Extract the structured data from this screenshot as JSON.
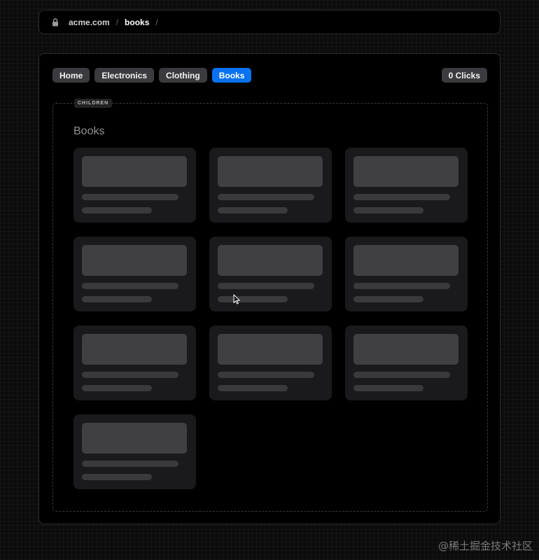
{
  "address_bar": {
    "domain": "acme.com",
    "separator": "/",
    "current": "books",
    "trailing_separator": "/"
  },
  "nav": {
    "tabs": [
      {
        "label": "Home",
        "active": false
      },
      {
        "label": "Electronics",
        "active": false
      },
      {
        "label": "Clothing",
        "active": false
      },
      {
        "label": "Books",
        "active": true
      }
    ],
    "clicks_label": "0 Clicks"
  },
  "children": {
    "label": "CHILDREN",
    "title": "Books",
    "card_count": 10
  },
  "colors": {
    "accent": "#0a72f0",
    "tab": "#3b3b3f",
    "card": "#1a1a1c",
    "skeleton": "#3f3f44"
  },
  "icons": {
    "lock": "lock-icon",
    "cursor": "mouse-pointer-icon"
  },
  "watermark": "@稀土掘金技术社区"
}
